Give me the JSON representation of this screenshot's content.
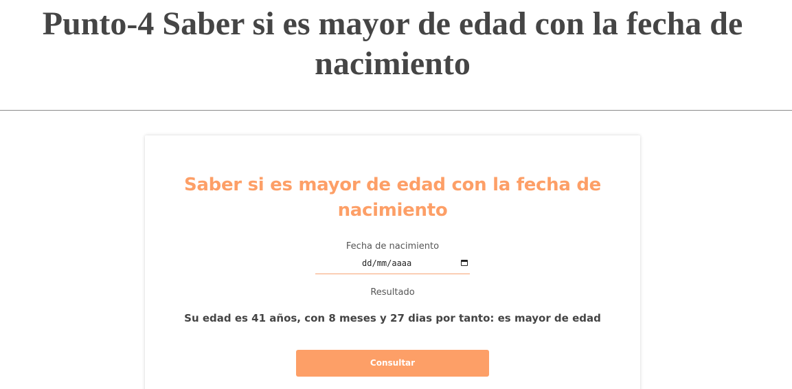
{
  "page": {
    "title": "Punto-4 Saber si es mayor de edad con la fecha de nacimiento"
  },
  "card": {
    "title": "Saber si es mayor de edad con la fecha de nacimiento",
    "birthdate_label": "Fecha de nacimiento",
    "birthdate_value": "dd/mm/aaaa",
    "result_label": "Resultado",
    "result_text": "Su edad es 41 años, con 8 meses y 27 dias por tanto: es mayor de edad",
    "consult_button": "Consultar"
  },
  "icons": {
    "date_picker": "calendar-icon"
  },
  "colors": {
    "accent": "#fd9f67",
    "title_text": "#454545",
    "body_text": "#444444"
  }
}
